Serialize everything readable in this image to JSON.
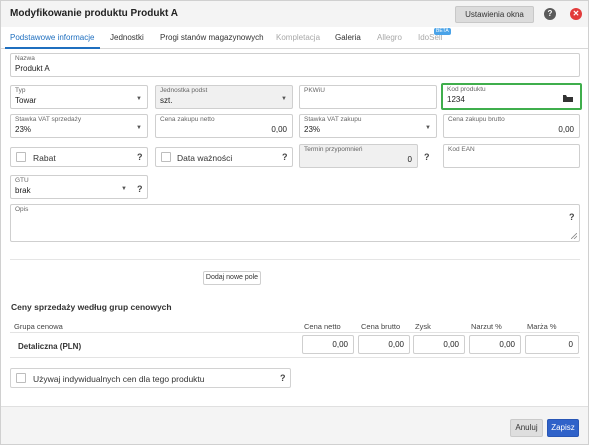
{
  "header": {
    "title": "Modyfikowanie produktu Produkt A",
    "settings_label": "Ustawienia okna",
    "help_glyph": "?",
    "close_glyph": "✕"
  },
  "tabs": [
    {
      "label": "Podstawowe informacje",
      "state": "active"
    },
    {
      "label": "Jednostki",
      "state": "normal"
    },
    {
      "label": "Progi stanów magazynowych",
      "state": "normal"
    },
    {
      "label": "Kompletacja",
      "state": "disabled"
    },
    {
      "label": "Galeria",
      "state": "normal"
    },
    {
      "label": "Allegro",
      "state": "disabled"
    },
    {
      "label": "IdoSell",
      "state": "disabled",
      "badge": "BETA"
    }
  ],
  "form": {
    "name": {
      "label": "Nazwa",
      "value": "Produkt A"
    },
    "type": {
      "label": "Typ",
      "value": "Towar"
    },
    "unit": {
      "label": "Jednostka podst",
      "value": "szt."
    },
    "pkwiu": {
      "label": "PKWiU",
      "value": ""
    },
    "product_code": {
      "label": "Kod produktu",
      "value": "1234"
    },
    "vat_sale": {
      "label": "Stawka VAT sprzedaży",
      "value": "23%"
    },
    "purchase_net": {
      "label": "Cena zakupu netto",
      "value": "0,00"
    },
    "vat_purchase": {
      "label": "Stawka VAT zakupu",
      "value": "23%"
    },
    "purchase_gross": {
      "label": "Cena zakupu brutto",
      "value": "0,00"
    },
    "rabat": {
      "label": "Rabat",
      "checked": false
    },
    "expiry": {
      "label": "Data ważności",
      "checked": false
    },
    "reminder": {
      "label": "Termin przypomnień",
      "value": "0"
    },
    "ean": {
      "label": "Kod EAN",
      "value": ""
    },
    "gtu": {
      "label": "GTU",
      "value": "brak"
    },
    "description": {
      "label": "Opis",
      "value": ""
    },
    "add_field_label": "Dodaj nowe pole",
    "help_glyph": "?"
  },
  "prices": {
    "section_title": "Ceny sprzedaży według grup cenowych",
    "columns": [
      "Grupa cenowa",
      "Cena netto",
      "Cena brutto",
      "Zysk",
      "Narzut %",
      "Marża %"
    ],
    "rows": [
      {
        "group": "Detaliczna (PLN)",
        "net": "0,00",
        "gross": "0,00",
        "profit": "0,00",
        "markup": "0,00",
        "margin": "0"
      }
    ],
    "individual_label": "Używaj indywidualnych cen dla tego produktu"
  },
  "footer": {
    "cancel_label": "Anuluj",
    "save_label": "Zapisz"
  },
  "colors": {
    "accent": "#1f6fbf",
    "save_button": "#2f62c9",
    "highlight": "#3fae4c",
    "close": "#e23b3b"
  }
}
